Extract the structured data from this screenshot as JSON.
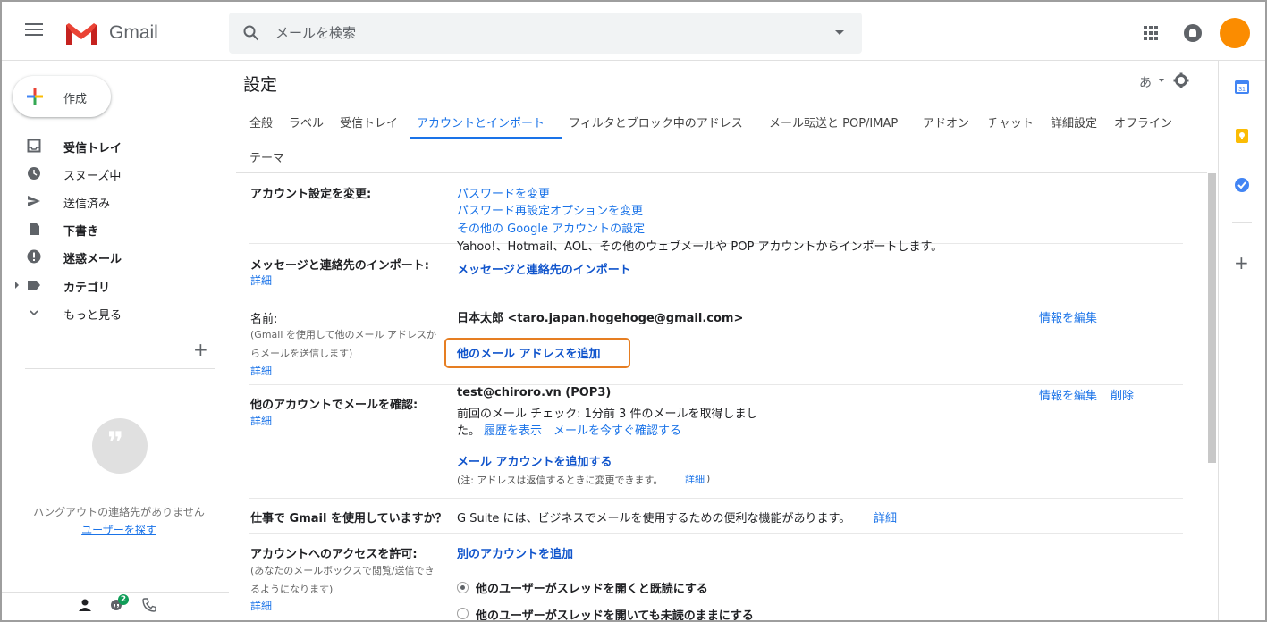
{
  "header": {
    "app_name": "Gmail",
    "search_placeholder": "メールを検索"
  },
  "sidebar": {
    "compose_label": "作成",
    "items": [
      {
        "label": "受信トレイ",
        "icon": "inbox-icon"
      },
      {
        "label": "スヌーズ中",
        "icon": "clock-icon"
      },
      {
        "label": "送信済み",
        "icon": "send-icon"
      },
      {
        "label": "下書き",
        "icon": "draft-icon"
      },
      {
        "label": "迷惑メール",
        "icon": "spam-icon"
      },
      {
        "label": "カテゴリ",
        "icon": "label-icon"
      },
      {
        "label": "もっと見る",
        "icon": "chevron-down-icon"
      }
    ],
    "hangouts_empty": "ハングアウトの連絡先がありません",
    "hangouts_find": "ユーザーを探す",
    "hangouts_badge": "2"
  },
  "settings": {
    "title": "設定",
    "lang_label": "あ",
    "tabs": [
      "全般",
      "ラベル",
      "受信トレイ",
      "アカウントとインポート",
      "フィルタとブロック中のアドレス",
      "メール転送と POP/IMAP",
      "アドオン",
      "チャット",
      "詳細設定",
      "オフライン",
      "テーマ"
    ],
    "change_account": {
      "label": "アカウント設定を変更:",
      "links": [
        "パスワードを変更",
        "パスワード再設定オプションを変更",
        "その他の Google アカウントの設定"
      ]
    },
    "import": {
      "label": "メッセージと連絡先のインポート:",
      "detail": "詳細",
      "desc": "Yahoo!、Hotmail、AOL、その他のウェブメールや POP アカウントからインポートします。",
      "link": "メッセージと連絡先のインポート"
    },
    "send_as": {
      "label": "名前:",
      "sub1": "(Gmail を使用して他のメール アドレスか",
      "sub2": "らメールを送信します)",
      "detail": "詳細",
      "address": "日本太郎 <taro.japan.hogehoge@gmail.com>",
      "edit": "情報を編集",
      "add": "他のメール アドレスを追加"
    },
    "check_mail": {
      "label": "他のアカウントでメールを確認:",
      "detail": "詳細",
      "account": "test@chiroro.vn (POP3)",
      "status1": "前回のメール チェック: 1分前 3 件のメールを取得しまし",
      "status2": "た。",
      "history": "履歴を表示",
      "check_now": "メールを今すぐ確認する",
      "edit": "情報を編集",
      "delete": "削除",
      "add_account": "メール アカウントを追加する",
      "note_prefix": "(注: アドレスは返信するときに変更できます。",
      "note_link": "詳細",
      "note_suffix": ")"
    },
    "gsuite": {
      "label": "仕事で Gmail を使用していますか？",
      "desc": "G Suite には、ビジネスでメールを使用するための便利な機能があります。",
      "link": "詳細"
    },
    "grant_access": {
      "label": "アカウントへのアクセスを許可:",
      "sub1": "(あなたのメールボックスで閲覧/送信でき",
      "sub2": "るようになります)",
      "detail": "詳細",
      "add": "別のアカウントを追加",
      "opt1": "他のユーザーがスレッドを開くと既読にする",
      "opt2": "他のユーザーがスレッドを開いても未読のままにする"
    }
  },
  "colors": {
    "accent": "#1a73e8",
    "highlight": "#e67e22",
    "avatar": "#fb8c00"
  }
}
